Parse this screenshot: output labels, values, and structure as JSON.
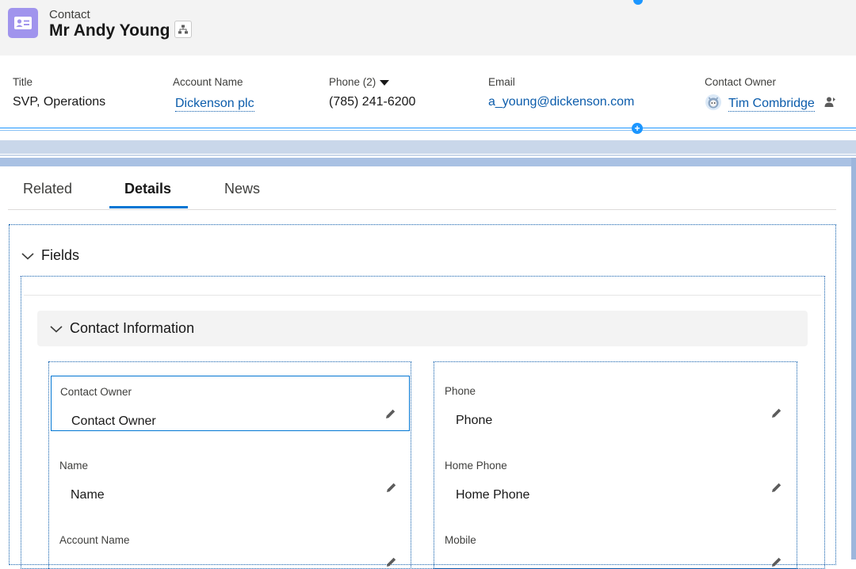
{
  "header": {
    "object_type": "Contact",
    "record_name": "Mr Andy Young",
    "object_icon": "contact-card-icon",
    "hierarchy_icon": "hierarchy-icon"
  },
  "highlights": {
    "title": {
      "label": "Title",
      "value": "SVP, Operations"
    },
    "account": {
      "label": "Account Name",
      "value": "Dickenson plc"
    },
    "phone": {
      "label": "Phone (2)",
      "value": "(785) 241-6200"
    },
    "email": {
      "label": "Email",
      "value": "a_young@dickenson.com"
    },
    "owner": {
      "label": "Contact Owner",
      "value": "Tim Combridge"
    }
  },
  "add_symbol": "+",
  "tabs": {
    "related": "Related",
    "details": "Details",
    "news": "News",
    "active": "Details"
  },
  "fields_section": {
    "label": "Fields"
  },
  "contact_info": {
    "label": "Contact Information"
  },
  "left_fields": [
    {
      "label": "Contact Owner",
      "value": "Contact Owner"
    },
    {
      "label": "Name",
      "value": "Name"
    },
    {
      "label": "Account Name",
      "value": ""
    }
  ],
  "right_fields": [
    {
      "label": "Phone",
      "value": "Phone"
    },
    {
      "label": "Home Phone",
      "value": "Home Phone"
    },
    {
      "label": "Mobile",
      "value": ""
    }
  ],
  "colors": {
    "accent": "#0176d3",
    "link": "#0b5cab",
    "contact_icon_bg": "#a094ed"
  }
}
